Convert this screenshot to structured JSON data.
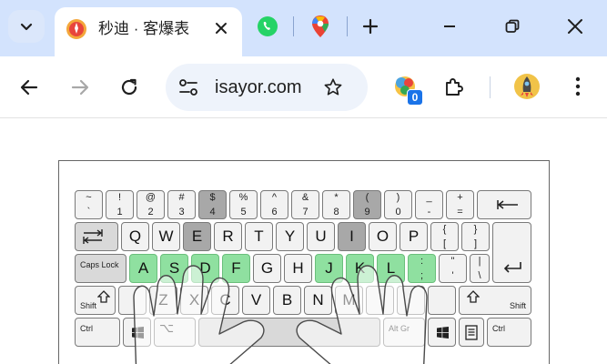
{
  "tabs": {
    "active_title": "秒迪 · 客爆表",
    "pinned": [
      "whatsapp-icon",
      "maps-icon"
    ]
  },
  "toolbar": {
    "url": "isayor.com",
    "extension_badge": "0"
  },
  "keyboard": {
    "row1": [
      {
        "top": "~",
        "bot": "`"
      },
      {
        "top": "!",
        "bot": "1"
      },
      {
        "top": "@",
        "bot": "2"
      },
      {
        "top": "#",
        "bot": "3"
      },
      {
        "top": "$",
        "bot": "4"
      },
      {
        "top": "%",
        "bot": "5"
      },
      {
        "top": "^",
        "bot": "6"
      },
      {
        "top": "&",
        "bot": "7"
      },
      {
        "top": "*",
        "bot": "8"
      },
      {
        "top": "(",
        "bot": "9"
      },
      {
        "top": ")",
        "bot": "0"
      },
      {
        "top": "_",
        "bot": "-"
      },
      {
        "top": "+",
        "bot": "="
      }
    ],
    "row2": [
      "Q",
      "W",
      "E",
      "R",
      "T",
      "Y",
      "U",
      "I",
      "O",
      "P"
    ],
    "row2_brackets": [
      {
        "top": "{",
        "bot": "["
      },
      {
        "top": "}",
        "bot": "]"
      }
    ],
    "row3": [
      "A",
      "S",
      "D",
      "F",
      "G",
      "H",
      "J",
      "K",
      "L"
    ],
    "row3_punct": [
      {
        "top": ":",
        "bot": ";"
      },
      {
        "top": "\"",
        "bot": "'"
      },
      {
        "top": "|",
        "bot": "\\"
      }
    ],
    "row4": [
      "Z",
      "X",
      "C",
      "V",
      "B",
      "N",
      "M"
    ],
    "caps_label": "Caps Lock",
    "shift_label": "Shift",
    "ctrl_label": "Ctrl",
    "altgr_label": "Alt Gr",
    "alt_symbol": "⌥"
  },
  "colors": {
    "tabstrip": "#d3e3fd",
    "highlight_green": "#8fe0a0",
    "pressed_grey": "#a8a8a8"
  }
}
